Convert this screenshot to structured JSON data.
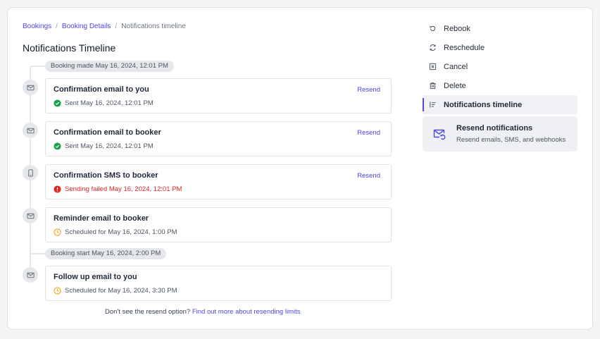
{
  "breadcrumb": {
    "items": [
      "Bookings",
      "Booking Details"
    ],
    "current": "Notifications timeline",
    "separator": "/"
  },
  "page_title": "Notifications Timeline",
  "timeline": {
    "markers": {
      "booking_made": "Booking made May 16, 2024, 12:01 PM",
      "booking_start": "Booking start May 16, 2024, 2:00 PM"
    },
    "notifications": [
      {
        "title": "Confirmation email to you",
        "status": "Sent May 16, 2024, 12:01 PM",
        "status_type": "sent",
        "icon": "mail-icon",
        "resend_label": "Resend"
      },
      {
        "title": "Confirmation email to booker",
        "status": "Sent May 16, 2024, 12:01 PM",
        "status_type": "sent",
        "icon": "mail-icon",
        "resend_label": "Resend"
      },
      {
        "title": "Confirmation SMS to booker",
        "status": "Sending failed May 16, 2024, 12:01 PM",
        "status_type": "failed",
        "icon": "phone-icon",
        "resend_label": "Resend"
      },
      {
        "title": "Reminder email to booker",
        "status": "Scheduled for May 16, 2024, 1:00 PM",
        "status_type": "scheduled",
        "icon": "mail-icon"
      },
      {
        "title": "Follow up email to you",
        "status": "Scheduled for May 16, 2024, 3:30 PM",
        "status_type": "scheduled",
        "icon": "mail-icon"
      }
    ]
  },
  "footer": {
    "text": "Don't see the resend option?",
    "link": "Find out more about resending limits"
  },
  "actions": {
    "items": [
      {
        "label": "Rebook",
        "icon": "rebook-icon"
      },
      {
        "label": "Reschedule",
        "icon": "reschedule-icon"
      },
      {
        "label": "Cancel",
        "icon": "cancel-icon"
      },
      {
        "label": "Delete",
        "icon": "trash-icon"
      },
      {
        "label": "Notifications timeline",
        "icon": "timeline-icon",
        "active": true
      }
    ],
    "resend": {
      "title": "Resend notifications",
      "subtitle": "Resend emails, SMS, and webhooks",
      "icon": "mail-resend-icon"
    }
  },
  "colors": {
    "accent": "#4f46e5",
    "sent": "#16a34a",
    "failed": "#dc2626",
    "scheduled": "#f59e0b"
  }
}
